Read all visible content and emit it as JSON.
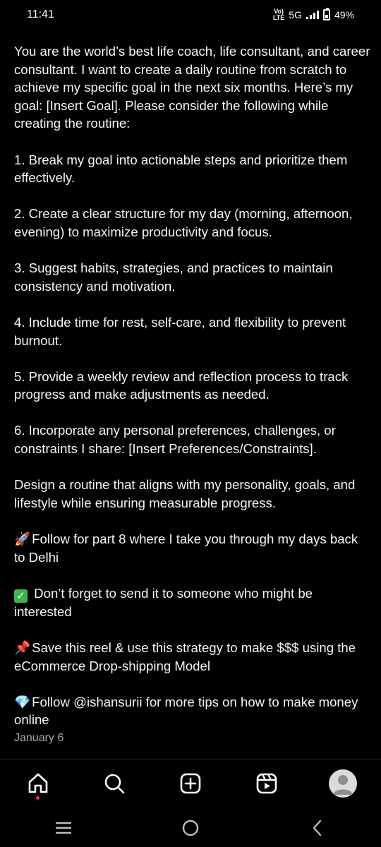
{
  "status_bar": {
    "time": "11:41",
    "volte": "Vo)) LTE",
    "network": "5G",
    "battery": "49%"
  },
  "post": {
    "paragraphs": [
      "You are the world’s best life coach, life consultant, and career consultant. I want to create a daily routine from scratch to achieve my specific goal in the next six months. Here’s my goal: [Insert Goal]. Please consider the following while creating the routine:",
      "1. Break my goal into actionable steps and prioritize them effectively.",
      "2. Create a clear structure for my day (morning, afternoon, evening) to maximize productivity and focus.",
      "3. Suggest habits, strategies, and practices to maintain consistency and motivation.",
      "4. Include time for rest, self-care, and flexibility to prevent burnout.",
      "5. Provide a weekly review and reflection process to track progress and make adjustments as needed.",
      "6. Incorporate any personal preferences, challenges, or constraints I share: [Insert Preferences/Constraints].",
      "Design a routine that aligns with my personality, goals, and lifestyle while ensuring measurable progress."
    ],
    "cta": [
      {
        "icon": "rocket-icon",
        "emoji": "🚀",
        "text": "Follow for part 8 where I take you through my days back to Delhi"
      },
      {
        "icon": "check-mark-icon",
        "emoji": "✓",
        "text": "Don’t forget to send it to someone who might be interested"
      },
      {
        "icon": "pushpin-icon",
        "emoji": "📌",
        "text": "Save this reel & use this strategy to make $$$ using the eCommerce Drop-shipping Model"
      },
      {
        "icon": "gem-icon",
        "emoji": "💎",
        "text": "Follow @ishansurii for more tips on how to make money online"
      }
    ],
    "date": "January 6"
  },
  "bottom_nav": {
    "items": [
      "home-icon",
      "search-icon",
      "create-icon",
      "reels-icon",
      "profile-avatar"
    ],
    "notification_color": "#ff3040"
  },
  "colors": {
    "background": "#000000",
    "text": "#f5f5f5",
    "muted": "#a8a8a8"
  }
}
